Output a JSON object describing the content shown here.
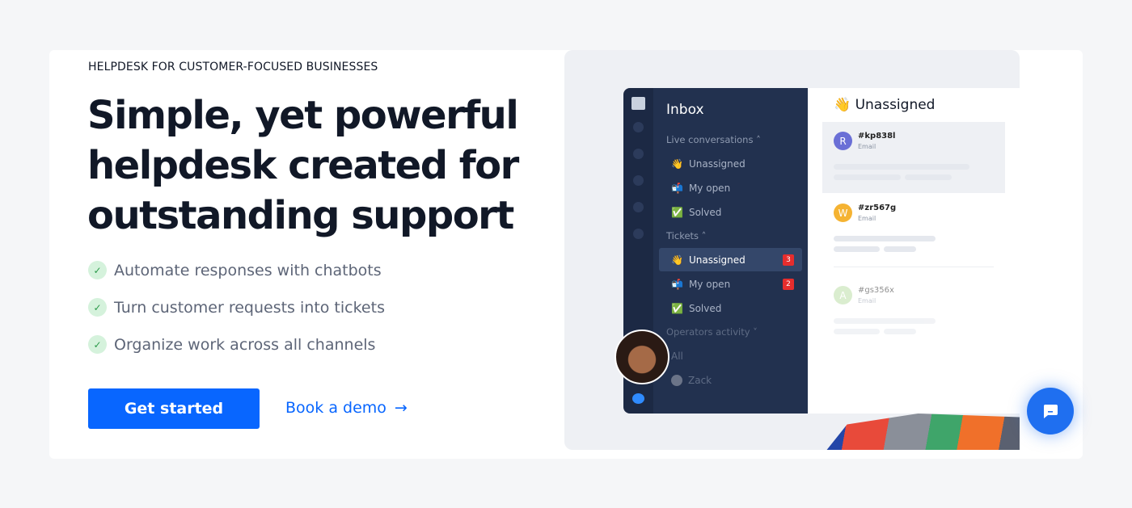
{
  "hero": {
    "eyebrow": "HELPDESK FOR CUSTOMER-FOCUSED BUSINESSES",
    "title": "Simple, yet powerful helpdesk created for outstanding support",
    "features": [
      "Automate responses with chatbots",
      "Turn customer requests into tickets",
      "Organize work across all channels"
    ],
    "primary_cta": "Get started",
    "secondary_cta": "Book a demo"
  },
  "app": {
    "nav_title": "Inbox",
    "live_section": "Live conversations",
    "live_items": [
      {
        "emoji": "👋",
        "label": "Unassigned"
      },
      {
        "emoji": "📬",
        "label": "My open"
      },
      {
        "emoji": "✅",
        "label": "Solved"
      }
    ],
    "tickets_section": "Tickets",
    "ticket_items": [
      {
        "emoji": "👋",
        "label": "Unassigned",
        "count": "3"
      },
      {
        "emoji": "📬",
        "label": "My open",
        "count": "2"
      },
      {
        "emoji": "✅",
        "label": "Solved"
      }
    ],
    "operators_section": "Operators activity",
    "operator_items": [
      "All",
      "Zack"
    ],
    "main_title": "Unassigned",
    "main_emoji": "👋",
    "tickets": [
      {
        "initial": "R",
        "id": "#kp838l",
        "channel": "Email",
        "color": "#6a6fd6"
      },
      {
        "initial": "W",
        "id": "#zr567g",
        "channel": "Email",
        "color": "#f5b332"
      },
      {
        "initial": "A",
        "id": "#gs356x",
        "channel": "Email",
        "color": "#b7dca0"
      }
    ]
  },
  "colors": {
    "accent": "#0866ff",
    "sidebar": "#22314f",
    "badge": "#e62d2d"
  }
}
